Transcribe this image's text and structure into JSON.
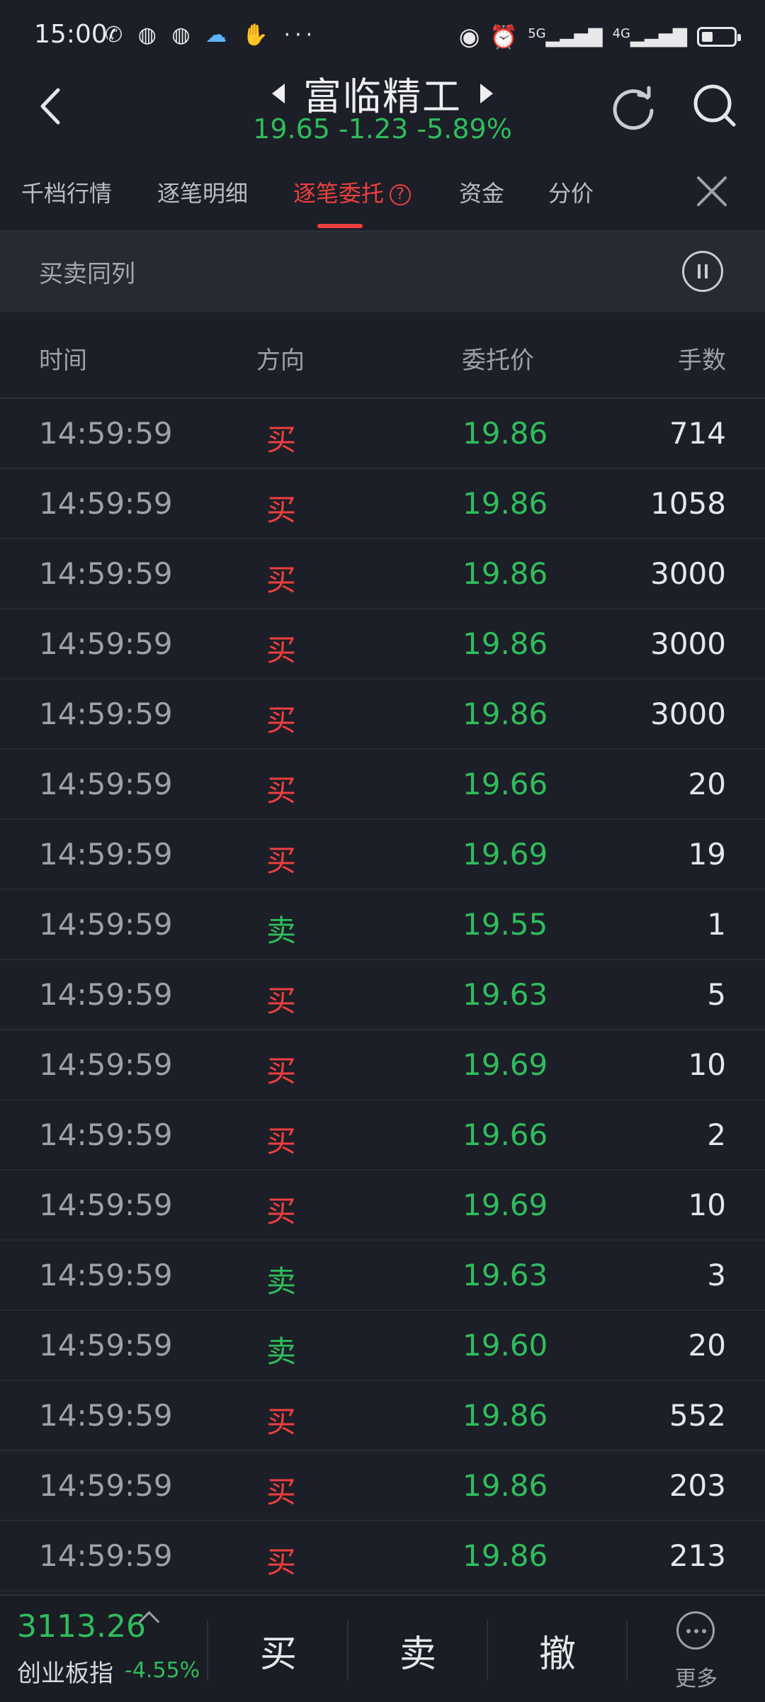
{
  "status_bar": {
    "time": "15:00",
    "left_icons": [
      "missed-call-icon",
      "wechat-icon",
      "wechat-icon",
      "weather-icon",
      "hand-icon",
      "more-icon"
    ],
    "right_icons": [
      "eye-icon",
      "alarm-icon",
      "signal-5g-icon",
      "signal-4g-icon",
      "battery-icon"
    ],
    "signal_5g": "5G",
    "signal_4g": "4G",
    "battery_level": 0.35
  },
  "header": {
    "title": "富临精工",
    "quote": "19.65 -1.23 -5.89%",
    "quote_color": "#2fbd5c"
  },
  "tabs": [
    {
      "label": "千档行情",
      "active": false
    },
    {
      "label": "逐笔明细",
      "active": false
    },
    {
      "label": "逐笔委托",
      "active": true,
      "help": "?"
    },
    {
      "label": "资金",
      "active": false
    },
    {
      "label": "分价",
      "active": false
    }
  ],
  "subbar": {
    "label": "买卖同列"
  },
  "table": {
    "columns": [
      "时间",
      "方向",
      "委托价",
      "手数"
    ],
    "rows": [
      {
        "time": "14:59:59",
        "dir": "买",
        "price": "19.86",
        "qty": "714"
      },
      {
        "time": "14:59:59",
        "dir": "买",
        "price": "19.86",
        "qty": "1058"
      },
      {
        "time": "14:59:59",
        "dir": "买",
        "price": "19.86",
        "qty": "3000"
      },
      {
        "time": "14:59:59",
        "dir": "买",
        "price": "19.86",
        "qty": "3000"
      },
      {
        "time": "14:59:59",
        "dir": "买",
        "price": "19.86",
        "qty": "3000"
      },
      {
        "time": "14:59:59",
        "dir": "买",
        "price": "19.66",
        "qty": "20"
      },
      {
        "time": "14:59:59",
        "dir": "买",
        "price": "19.69",
        "qty": "19"
      },
      {
        "time": "14:59:59",
        "dir": "卖",
        "price": "19.55",
        "qty": "1"
      },
      {
        "time": "14:59:59",
        "dir": "买",
        "price": "19.63",
        "qty": "5"
      },
      {
        "time": "14:59:59",
        "dir": "买",
        "price": "19.69",
        "qty": "10"
      },
      {
        "time": "14:59:59",
        "dir": "买",
        "price": "19.66",
        "qty": "2"
      },
      {
        "time": "14:59:59",
        "dir": "买",
        "price": "19.69",
        "qty": "10"
      },
      {
        "time": "14:59:59",
        "dir": "卖",
        "price": "19.63",
        "qty": "3"
      },
      {
        "time": "14:59:59",
        "dir": "卖",
        "price": "19.60",
        "qty": "20"
      },
      {
        "time": "14:59:59",
        "dir": "买",
        "price": "19.86",
        "qty": "552"
      },
      {
        "time": "14:59:59",
        "dir": "买",
        "price": "19.86",
        "qty": "203"
      },
      {
        "time": "14:59:59",
        "dir": "买",
        "price": "19.86",
        "qty": "213"
      }
    ]
  },
  "bottom": {
    "index_value": "3113.26",
    "index_name": "创业板指",
    "index_pct": "-4.55%",
    "buy_label": "买",
    "sell_label": "卖",
    "cancel_label": "撤",
    "more_label": "更多"
  },
  "colors": {
    "buy": "#ee3f3f",
    "sell": "#2fbd5c",
    "background": "#1c1f27",
    "accent": "#ee3f3f"
  }
}
